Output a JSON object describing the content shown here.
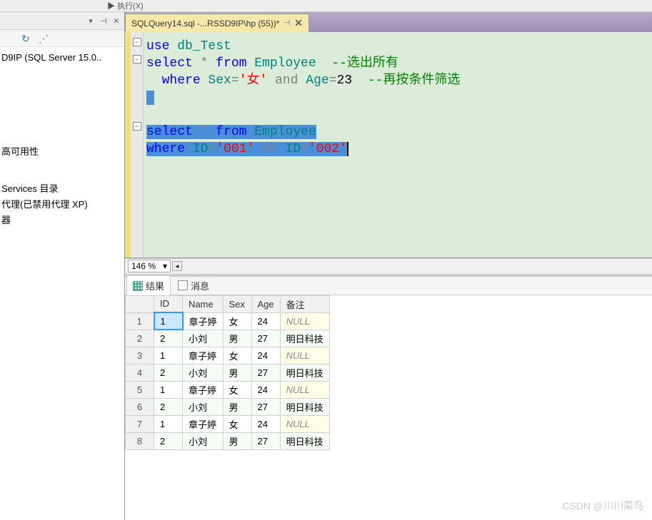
{
  "topbar": {
    "run_label": "执行(X)"
  },
  "left": {
    "icons": {
      "dropdown": "▾",
      "pin": "⊣",
      "close": "✕",
      "refresh": "↻",
      "activity": "⋰"
    },
    "tree": {
      "server": "D9IP (SQL Server 15.0..",
      "ha": "高可用性",
      "services": "Services 目录",
      "agent": "代理(已禁用代理 XP)",
      "other": "器"
    }
  },
  "tab": {
    "title": "SQLQuery14.sql -...RSSD9IP\\hp (55))*",
    "pin": "⊣",
    "close": "✕"
  },
  "code": {
    "l1_kw": "use",
    "l1_id": " db_Test",
    "l2_kw": "select",
    "l2_op1": " * ",
    "l2_kw2": "from",
    "l2_id": " Employee  ",
    "l2_c": "--选出所有",
    "l3_pad": "  ",
    "l3_kw": "where",
    "l3_id": " Sex",
    "l3_op": "=",
    "l3_str": "'女'",
    "l3_and": " and ",
    "l3_id2": "Age",
    "l3_op2": "=",
    "l3_num": "23",
    "l3_pad2": "  ",
    "l3_c": "--再按条件筛选",
    "l6_kw": "select",
    "l6_op1": " * ",
    "l6_kw2": "from",
    "l6_id": " Employee",
    "l7_kw": "where",
    "l7_id": " ID",
    "l7_op": "=",
    "l7_str": "'001'",
    "l7_or": " or ",
    "l7_id2": "ID",
    "l7_op2": "=",
    "l7_str2": "'002'"
  },
  "zoom": {
    "value": "146 %",
    "arrows": {
      "left": "◂",
      "up": "▲"
    }
  },
  "results_tabs": {
    "results": "结果",
    "messages": "消息"
  },
  "grid": {
    "headers": [
      "",
      "ID",
      "Name",
      "Sex",
      "Age",
      "备注"
    ],
    "rows": [
      {
        "n": "1",
        "id": "1",
        "name": "章子婷",
        "sex": "女",
        "age": "24",
        "remark": "NULL"
      },
      {
        "n": "2",
        "id": "2",
        "name": "小刘",
        "sex": "男",
        "age": "27",
        "remark": "明日科技"
      },
      {
        "n": "3",
        "id": "1",
        "name": "章子婷",
        "sex": "女",
        "age": "24",
        "remark": "NULL"
      },
      {
        "n": "4",
        "id": "2",
        "name": "小刘",
        "sex": "男",
        "age": "27",
        "remark": "明日科技"
      },
      {
        "n": "5",
        "id": "1",
        "name": "章子婷",
        "sex": "女",
        "age": "24",
        "remark": "NULL"
      },
      {
        "n": "6",
        "id": "2",
        "name": "小刘",
        "sex": "男",
        "age": "27",
        "remark": "明日科技"
      },
      {
        "n": "7",
        "id": "1",
        "name": "章子婷",
        "sex": "女",
        "age": "24",
        "remark": "NULL"
      },
      {
        "n": "8",
        "id": "2",
        "name": "小刘",
        "sex": "男",
        "age": "27",
        "remark": "明日科技"
      }
    ]
  },
  "watermark": "CSDN @川川菜鸟"
}
